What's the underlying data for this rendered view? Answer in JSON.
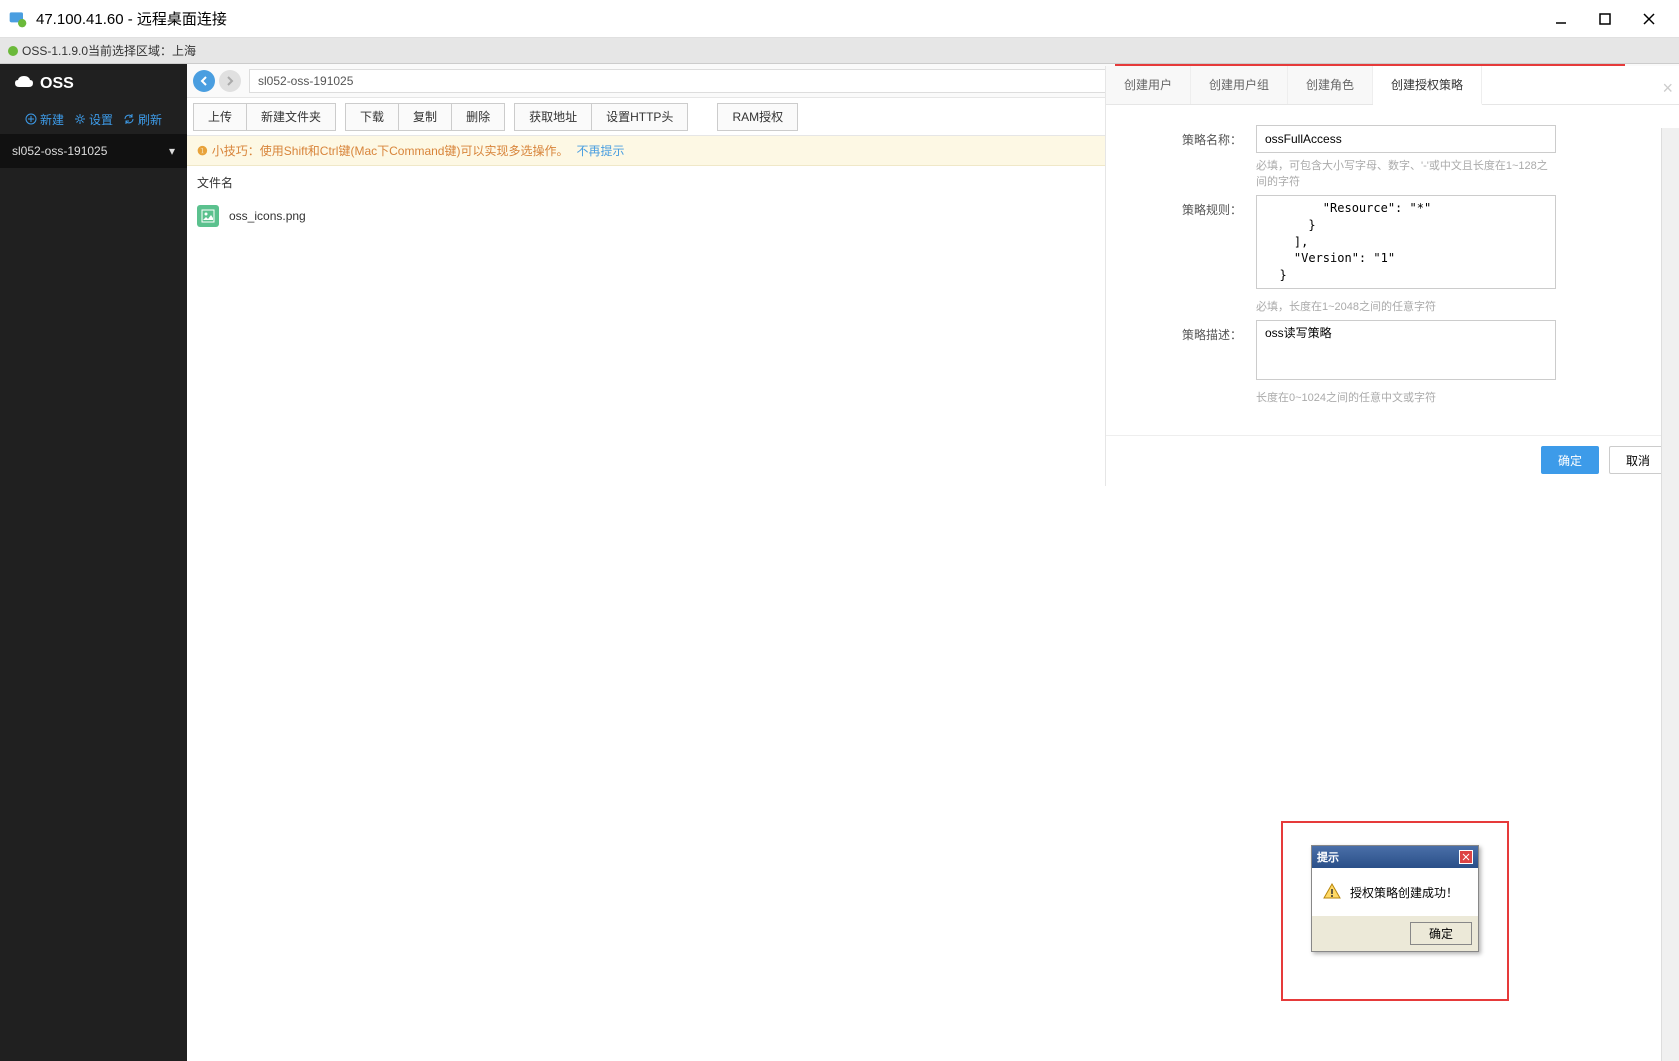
{
  "titlebar": {
    "text": "47.100.41.60 - 远程桌面连接"
  },
  "statusbar": {
    "text": "OSS-1.1.9.0当前选择区域：上海"
  },
  "sidebar": {
    "brand": "OSS",
    "actions": {
      "new": "新建",
      "settings": "设置",
      "refresh": "刷新"
    },
    "bucket": "sl052-oss-191025"
  },
  "nav": {
    "breadcrumb": "sl052-oss-191025"
  },
  "toolbar": {
    "upload": "上传",
    "newfolder": "新建文件夹",
    "download": "下载",
    "copy": "复制",
    "delete": "删除",
    "geturl": "获取地址",
    "sethttp": "设置HTTP头",
    "ram": "RAM授权"
  },
  "tip": {
    "label": "小技巧：",
    "text": "使用Shift和Ctrl键(Mac下Command键)可以实现多选操作。",
    "link": "不再提示"
  },
  "filelist": {
    "header": "文件名",
    "items": [
      {
        "name": "oss_icons.png"
      }
    ]
  },
  "panel": {
    "tabs": {
      "user": "创建用户",
      "usergroup": "创建用户组",
      "role": "创建角色",
      "policy": "创建授权策略"
    },
    "form": {
      "name_label": "策略名称：",
      "name_value": "ossFullAccess",
      "name_hint": "必填，可包含大小写字母、数字、'-'或中文且长度在1~128之间的字符",
      "rule_label": "策略规则：",
      "rule_value": "        \"Resource\": \"*\"\n      }\n    ],\n    \"Version\": \"1\"\n  }",
      "rule_hint": "必填，长度在1~2048之间的任意字符",
      "desc_label": "策略描述：",
      "desc_value": "oss读写策略",
      "desc_hint": "长度在0~1024之间的任意中文或字符"
    },
    "buttons": {
      "ok": "确定",
      "cancel": "取消"
    }
  },
  "alert": {
    "title": "提示",
    "message": "授权策略创建成功！",
    "ok": "确定"
  }
}
